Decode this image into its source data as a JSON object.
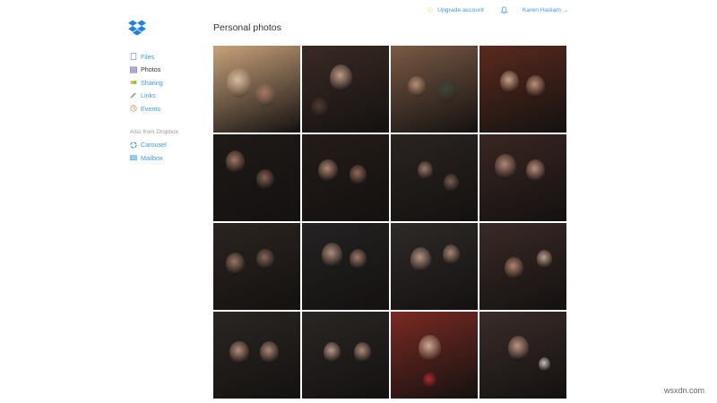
{
  "app": {
    "logo_icon": "dropbox-icon"
  },
  "header": {
    "upgrade_label": "Upgrade account",
    "upgrade_icon": "star-icon",
    "notifications_icon": "bell-icon",
    "user_name": "Karen Haslam",
    "user_menu_icon": "chevron-down-icon"
  },
  "sidebar": {
    "items": [
      {
        "label": "Files",
        "icon": "file-icon",
        "active": false
      },
      {
        "label": "Photos",
        "icon": "photo-icon",
        "active": true
      },
      {
        "label": "Sharing",
        "icon": "sharing-icon",
        "active": false
      },
      {
        "label": "Links",
        "icon": "link-icon",
        "active": false
      },
      {
        "label": "Events",
        "icon": "events-icon",
        "active": false
      }
    ],
    "also_label": "Also from Dropbox",
    "also_items": [
      {
        "label": "Carousel",
        "icon": "carousel-icon"
      },
      {
        "label": "Mailbox",
        "icon": "mailbox-icon"
      }
    ]
  },
  "main": {
    "title": "Personal photos"
  },
  "photos": [
    {
      "tone": "#c9a27a"
    },
    {
      "tone": "#3a2a24"
    },
    {
      "tone": "#7a5a45"
    },
    {
      "tone": "#5a2a1e"
    },
    {
      "tone": "#1f1a18"
    },
    {
      "tone": "#241c18"
    },
    {
      "tone": "#2a2420"
    },
    {
      "tone": "#3a2622"
    },
    {
      "tone": "#2b2420"
    },
    {
      "tone": "#242222"
    },
    {
      "tone": "#2e2a28"
    },
    {
      "tone": "#3a2a26"
    },
    {
      "tone": "#2a2622"
    },
    {
      "tone": "#2a2624"
    },
    {
      "tone": "#7a2a22"
    },
    {
      "tone": "#3a2c2a"
    }
  ],
  "watermark": "wsxdn.com",
  "colors": {
    "link": "#3d9ae8",
    "accent_star": "#f2c12e",
    "dropbox_blue": "#1a82e2"
  }
}
